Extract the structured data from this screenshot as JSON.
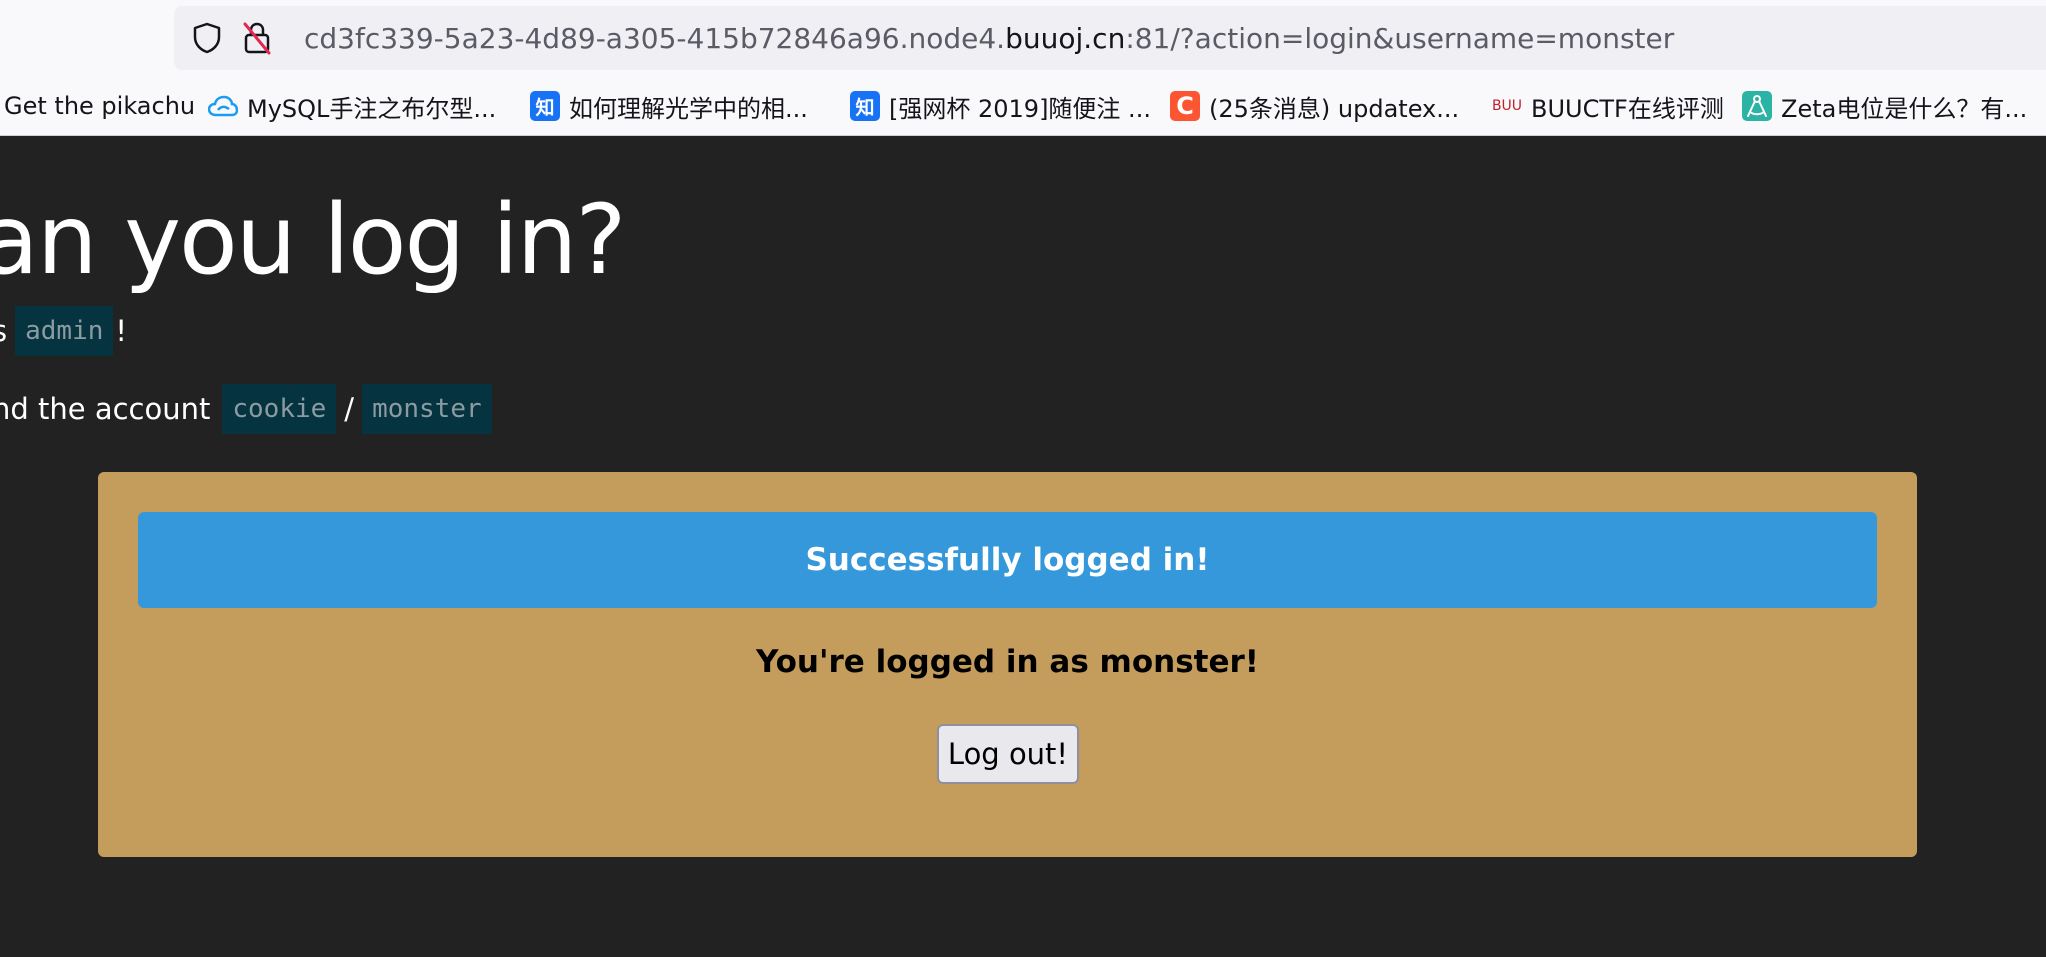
{
  "browser": {
    "url": {
      "prefix": "cd3fc339-5a23-4d89-a305-415b72846a96.node4.",
      "host": "buuoj.cn",
      "suffix": ":81/?action=login&username=monster"
    },
    "bookmarks": [
      {
        "label": "Get the pikachu",
        "icon": "none"
      },
      {
        "label": "MySQL手注之布尔型...",
        "icon": "cloud-icon"
      },
      {
        "label": "如何理解光学中的相...",
        "icon": "zhihu-icon",
        "icon_text": "知"
      },
      {
        "label": "[强网杯 2019]随便注 ...",
        "icon": "zhihu-icon",
        "icon_text": "知"
      },
      {
        "label": "(25条消息) updatex...",
        "icon": "csdn-icon",
        "icon_text": "C"
      },
      {
        "label": "BUUCTF在线评测",
        "icon": "buuoj-icon",
        "icon_text": "BUU"
      },
      {
        "label": "Zeta电位是什么？有...",
        "icon": "compass-icon"
      }
    ]
  },
  "page": {
    "title": "an you log in?",
    "line1": {
      "text_before": "s",
      "code": "admin",
      "text_after": "!"
    },
    "line2": {
      "text_before": "nd the account",
      "code1": "cookie",
      "separator": "/",
      "code2": "monster"
    },
    "alert": "Successfully logged in!",
    "status": "You're logged in as monster!",
    "logout_label": "Log out!"
  },
  "colors": {
    "background": "#222222",
    "panel": "#c49d5d",
    "alert": "#3498db",
    "code_bg": "#063340"
  }
}
